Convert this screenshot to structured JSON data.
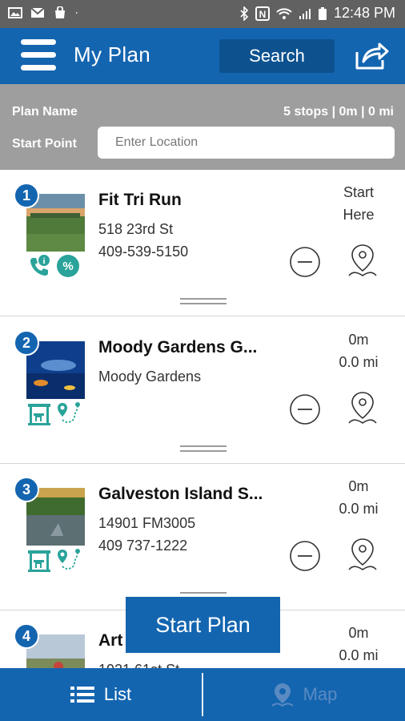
{
  "statusbar": {
    "time": "12:48 PM"
  },
  "appbar": {
    "title": "My Plan",
    "search_label": "Search"
  },
  "plan": {
    "name_label": "Plan Name",
    "summary": "5 stops | 0m | 0 mi",
    "start_label": "Start Point",
    "start_placeholder": "Enter Location"
  },
  "stops": [
    {
      "number": "1",
      "name": "Fit Tri Run",
      "line1": "518 23rd St",
      "line2": "409-539-5150",
      "dist1": "Start",
      "dist2": "Here",
      "icons": [
        "phone-icon",
        "info-icon",
        "discount-icon"
      ]
    },
    {
      "number": "2",
      "name": "Moody Gardens G...",
      "line1": "Moody Gardens",
      "line2": "",
      "dist1": "0m",
      "dist2": "0.0 mi",
      "icons": [
        "attraction-icon",
        "route-icon"
      ]
    },
    {
      "number": "3",
      "name": "Galveston Island S...",
      "line1": "14901 FM3005",
      "line2": "409 737-1222",
      "dist1": "0m",
      "dist2": "0.0 mi",
      "icons": [
        "attraction-icon",
        "route-icon"
      ]
    },
    {
      "number": "4",
      "name": "Art",
      "line1": "1921 61st St",
      "line2": "",
      "dist1": "0m",
      "dist2": "0.0 mi",
      "icons": []
    }
  ],
  "start_plan_label": "Start Plan",
  "tabs": {
    "list": "List",
    "map": "Map"
  },
  "colors": {
    "primary": "#1465b0",
    "teal": "#2aa39a",
    "gray": "#9e9e9e"
  }
}
